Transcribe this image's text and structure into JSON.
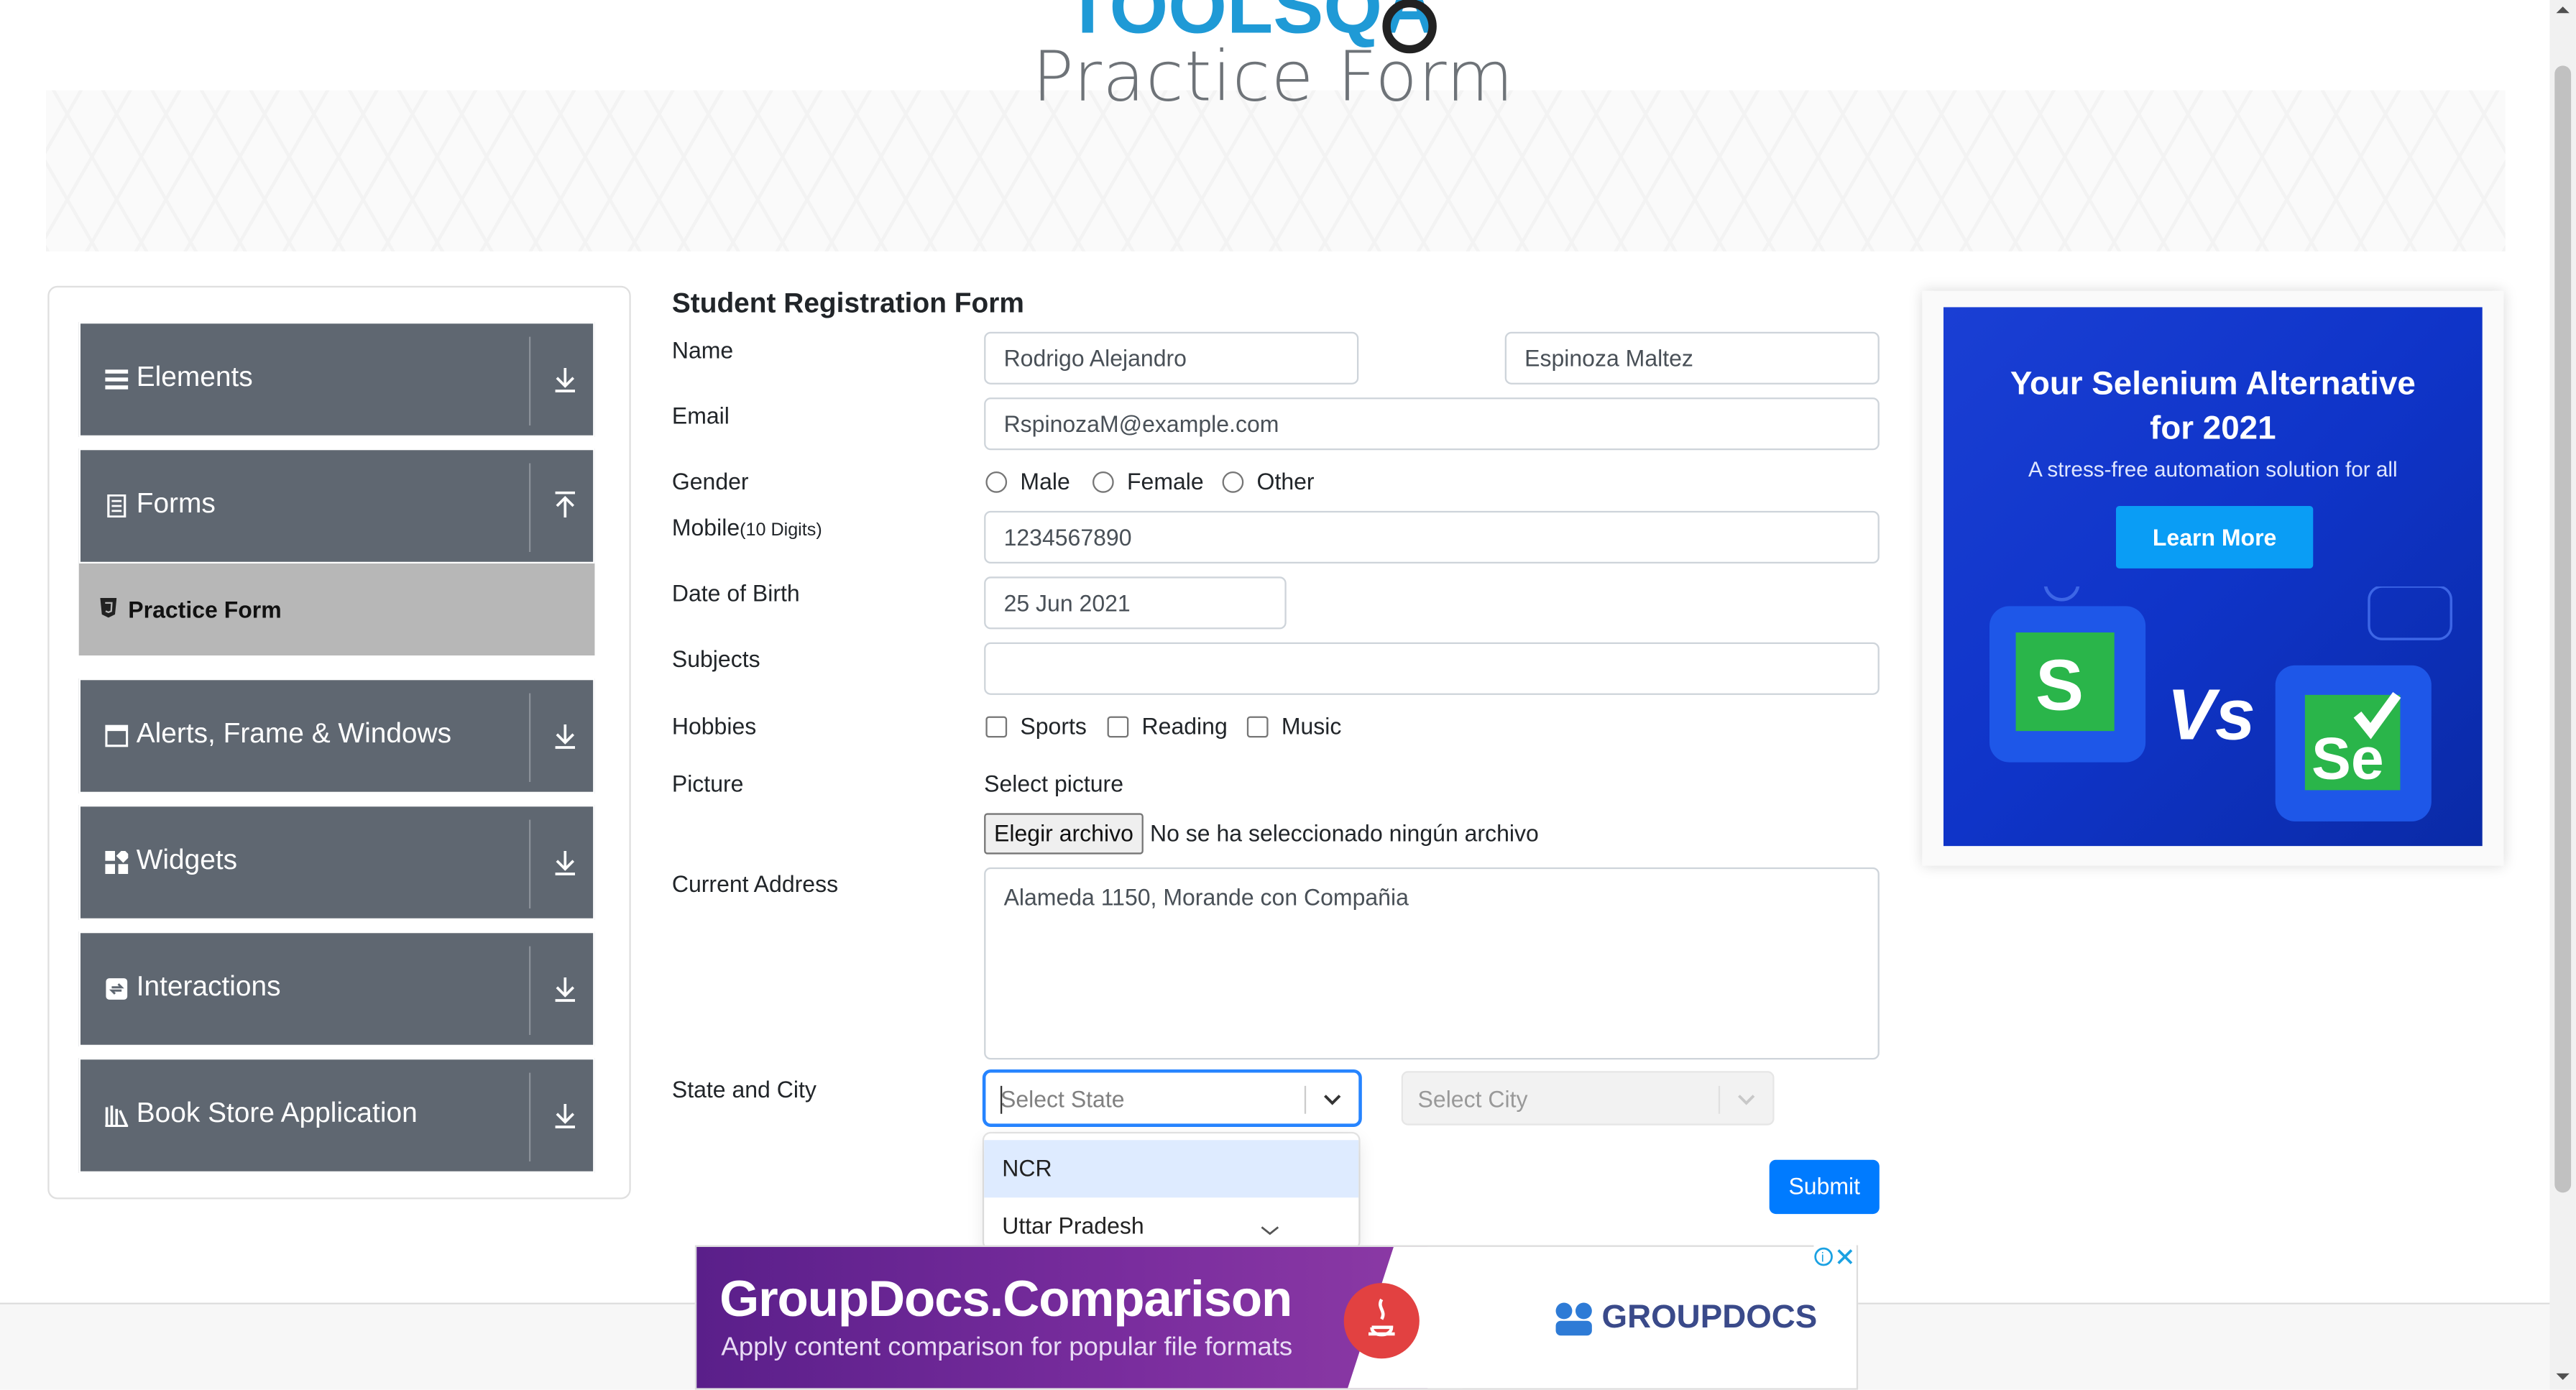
{
  "header": {
    "logo_text": "TOOLSQA"
  },
  "banner": {
    "title": "Practice Form"
  },
  "sidebar": {
    "groups": [
      {
        "label": "Elements",
        "icon": "list-icon",
        "arrow": "download-arrow-icon"
      },
      {
        "label": "Forms",
        "icon": "form-icon",
        "arrow": "upload-arrow-icon"
      },
      {
        "label": "Alerts, Frame & Windows",
        "icon": "window-icon",
        "arrow": "download-arrow-icon"
      },
      {
        "label": "Widgets",
        "icon": "widgets-icon",
        "arrow": "download-arrow-icon"
      },
      {
        "label": "Interactions",
        "icon": "interactions-icon",
        "arrow": "download-arrow-icon"
      },
      {
        "label": "Book Store Application",
        "icon": "book-icon",
        "arrow": "download-arrow-icon"
      }
    ],
    "active_item": {
      "label": "Practice Form",
      "icon": "html5-icon"
    }
  },
  "form": {
    "title": "Student Registration Form",
    "labels": {
      "name": "Name",
      "email": "Email",
      "gender": "Gender",
      "mobile": "Mobile",
      "mobile_hint": "(10 Digits)",
      "dob": "Date of Birth",
      "subjects": "Subjects",
      "hobbies": "Hobbies",
      "picture": "Picture",
      "address": "Current Address",
      "state_city": "State and City"
    },
    "first_name": "Rodrigo Alejandro",
    "last_name": "Espinoza Maltez",
    "email": "RspinozaM@example.com",
    "gender_options": [
      "Male",
      "Female",
      "Other"
    ],
    "mobile": "1234567890",
    "dob": "25 Jun 2021",
    "subjects": "",
    "hobby_options": [
      "Sports",
      "Reading",
      "Music"
    ],
    "picture_label": "Select picture",
    "file_button": "Elegir archivo",
    "file_status": "No se ha seleccionado ningún archivo",
    "address": "Alameda 1150, Morande con Compañia",
    "state_placeholder": "Select State",
    "city_placeholder": "Select City",
    "state_options": [
      "NCR",
      "Uttar Pradesh"
    ],
    "submit": "Submit"
  },
  "ad_right": {
    "title": "Your Selenium Alternative for 2021",
    "subtitle": "A stress-free automation solution for all",
    "button": "Learn More",
    "vs": "Vs"
  },
  "ad_bottom": {
    "headline": "GroupDocs.Comparison",
    "subline": "Apply content comparison for popular file formats",
    "brand": "GROUPDOCS"
  },
  "colors": {
    "sidebar_group": "#5f6771",
    "active_item": "#b7b7b7",
    "submit": "#007bff",
    "focus_border": "#2684ff",
    "option_highlight": "#deebff"
  }
}
